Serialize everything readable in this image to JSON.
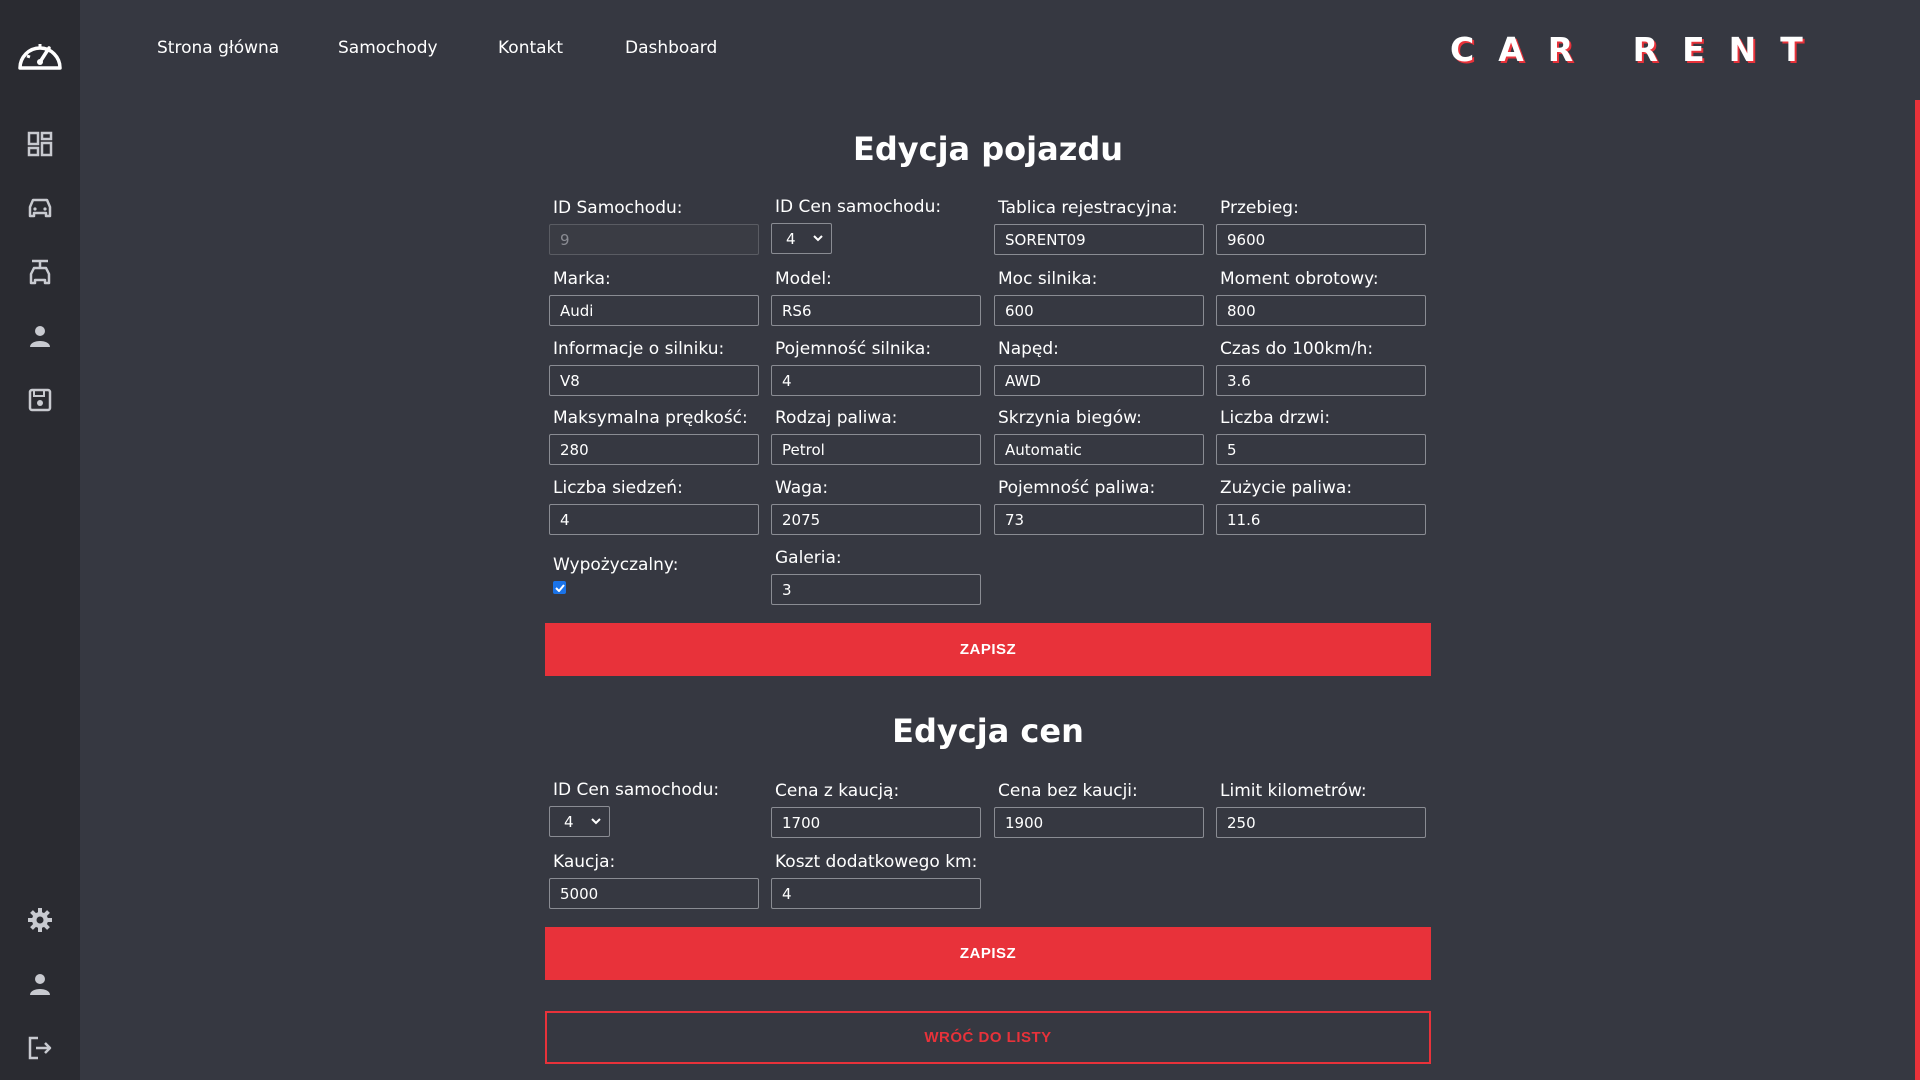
{
  "sidebar": {
    "icons": [
      "speedometer-icon",
      "dashboard-icon",
      "car-icon",
      "car-rental-icon",
      "user-icon",
      "save-icon",
      "settings-icon",
      "account-icon",
      "logout-icon"
    ]
  },
  "nav": {
    "home": "Strona główna",
    "cars": "Samochody",
    "contact": "Kontakt",
    "dashboard": "Dashboard"
  },
  "brand": "CAR RENT",
  "colors": {
    "accent": "#e8323a",
    "background": "#363841",
    "sidebar": "#2a2b31"
  },
  "vehicle": {
    "title": "Edycja pojazdu",
    "fields": {
      "car_id": {
        "label": "ID Samochodu:",
        "value": "9"
      },
      "price_id": {
        "label": "ID Cen samochodu:",
        "value": "4"
      },
      "plate": {
        "label": "Tablica rejestracyjna:",
        "value": "SORENT09"
      },
      "mileage": {
        "label": "Przebieg:",
        "value": "9600"
      },
      "brand": {
        "label": "Marka:",
        "value": "Audi"
      },
      "model": {
        "label": "Model:",
        "value": "RS6"
      },
      "power": {
        "label": "Moc silnika:",
        "value": "600"
      },
      "torque": {
        "label": "Moment obrotowy:",
        "value": "800"
      },
      "engine_info": {
        "label": "Informacje o silniku:",
        "value": "V8"
      },
      "displacement": {
        "label": "Pojemność silnika:",
        "value": "4"
      },
      "drive": {
        "label": "Napęd:",
        "value": "AWD"
      },
      "accel": {
        "label": "Czas do 100km/h:",
        "value": "3.6"
      },
      "top_speed": {
        "label": "Maksymalna prędkość:",
        "value": "280"
      },
      "fuel_type": {
        "label": "Rodzaj paliwa:",
        "value": "Petrol"
      },
      "gearbox": {
        "label": "Skrzynia biegów:",
        "value": "Automatic"
      },
      "doors": {
        "label": "Liczba drzwi:",
        "value": "5"
      },
      "seats": {
        "label": "Liczba siedzeń:",
        "value": "4"
      },
      "weight": {
        "label": "Waga:",
        "value": "2075"
      },
      "tank": {
        "label": "Pojemność paliwa:",
        "value": "73"
      },
      "consumption": {
        "label": "Zużycie paliwa:",
        "value": "11.6"
      },
      "rentable": {
        "label": "Wypożyczalny:",
        "checked": true
      },
      "gallery": {
        "label": "Galeria:",
        "value": "3"
      }
    },
    "save_label": "ZAPISZ"
  },
  "prices": {
    "title": "Edycja cen",
    "fields": {
      "price_id": {
        "label": "ID Cen samochodu:",
        "value": "4"
      },
      "with_deposit": {
        "label": "Cena z kaucją:",
        "value": "1700"
      },
      "without_deposit": {
        "label": "Cena bez kaucji:",
        "value": "1900"
      },
      "km_limit": {
        "label": "Limit kilometrów:",
        "value": "250"
      },
      "deposit": {
        "label": "Kaucja:",
        "value": "5000"
      },
      "extra_km": {
        "label": "Koszt dodatkowego km:",
        "value": "4"
      }
    },
    "save_label": "ZAPISZ",
    "back_label": "WRÓĆ DO LISTY"
  }
}
